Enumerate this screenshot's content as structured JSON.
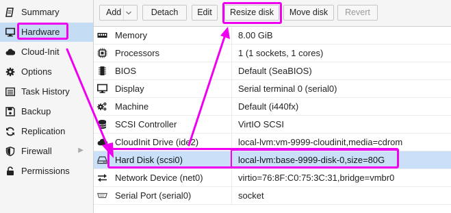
{
  "nav": {
    "items": [
      {
        "label": "Summary",
        "icon": "summary-icon"
      },
      {
        "label": "Hardware",
        "icon": "monitor-icon"
      },
      {
        "label": "Cloud-Init",
        "icon": "cloud-icon"
      },
      {
        "label": "Options",
        "icon": "gear-icon"
      },
      {
        "label": "Task History",
        "icon": "list-icon"
      },
      {
        "label": "Backup",
        "icon": "floppy-icon"
      },
      {
        "label": "Replication",
        "icon": "sync-icon"
      },
      {
        "label": "Firewall",
        "icon": "shield-icon"
      },
      {
        "label": "Permissions",
        "icon": "unlock-icon"
      }
    ],
    "active": "Hardware"
  },
  "toolbar": {
    "add": "Add",
    "detach": "Detach",
    "edit": "Edit",
    "resize": "Resize disk",
    "move": "Move disk",
    "revert": "Revert"
  },
  "hardware": {
    "rows": [
      {
        "name": "Memory",
        "value": "8.00 GiB",
        "icon": "memory-icon"
      },
      {
        "name": "Processors",
        "value": "1 (1 sockets, 1 cores)",
        "icon": "cpu-icon"
      },
      {
        "name": "BIOS",
        "value": "Default (SeaBIOS)",
        "icon": "chip-icon"
      },
      {
        "name": "Display",
        "value": "Serial terminal 0 (serial0)",
        "icon": "desktop-icon"
      },
      {
        "name": "Machine",
        "value": "Default (i440fx)",
        "icon": "cogs-icon"
      },
      {
        "name": "SCSI Controller",
        "value": "VirtIO SCSI",
        "icon": "database-icon"
      },
      {
        "name": "CloudInit Drive (ide2)",
        "value": "local-lvm:vm-9999-cloudinit,media=cdrom",
        "icon": "cloud-icon"
      },
      {
        "name": "Hard Disk (scsi0)",
        "value": "local-lvm:base-9999-disk-0,size=80G",
        "icon": "hdd-icon"
      },
      {
        "name": "Network Device (net0)",
        "value": "virtio=76:8F:C0:75:3C:31,bridge=vmbr0",
        "icon": "exchange-icon"
      },
      {
        "name": "Serial Port (serial0)",
        "value": "socket",
        "icon": "serial-icon"
      }
    ],
    "selected": "Hard Disk (scsi0)"
  },
  "colors": {
    "annotation": "#f000f0",
    "selection": "#c9e0f8",
    "nav_active": "#c5dcf5"
  }
}
